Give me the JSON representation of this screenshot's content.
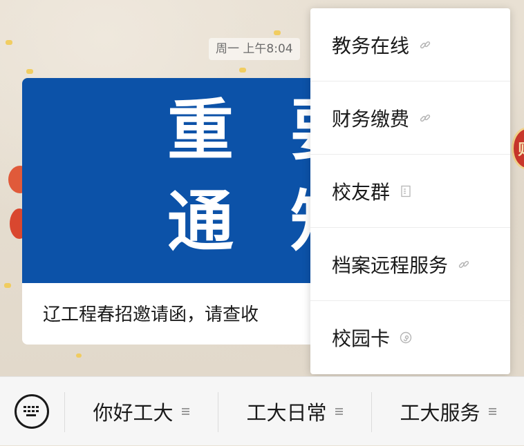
{
  "chat": {
    "timestamp": "周一 上午8:04",
    "card": {
      "image_chars": [
        "重",
        "要",
        "通",
        "知"
      ],
      "caption": "辽工程春招邀请函，请查收"
    },
    "side_badge_char": "则"
  },
  "menu": {
    "items": [
      {
        "label": "教务在线",
        "icon": "link-icon"
      },
      {
        "label": "财务缴费",
        "icon": "link-icon"
      },
      {
        "label": "校友群",
        "icon": "document-icon"
      },
      {
        "label": "档案远程服务",
        "icon": "link-icon"
      },
      {
        "label": "校园卡",
        "icon": "mini-program-icon"
      }
    ]
  },
  "bottom_bar": {
    "keyboard_icon": "keyboard-icon",
    "tabs": [
      {
        "label": "你好工大"
      },
      {
        "label": "工大日常"
      },
      {
        "label": "工大服务"
      }
    ]
  },
  "colors": {
    "card_blue": "#0c52a8",
    "wallpaper": "#e9e1d4",
    "menu_bg": "#ffffff",
    "bar_bg": "#f6f6f6"
  }
}
